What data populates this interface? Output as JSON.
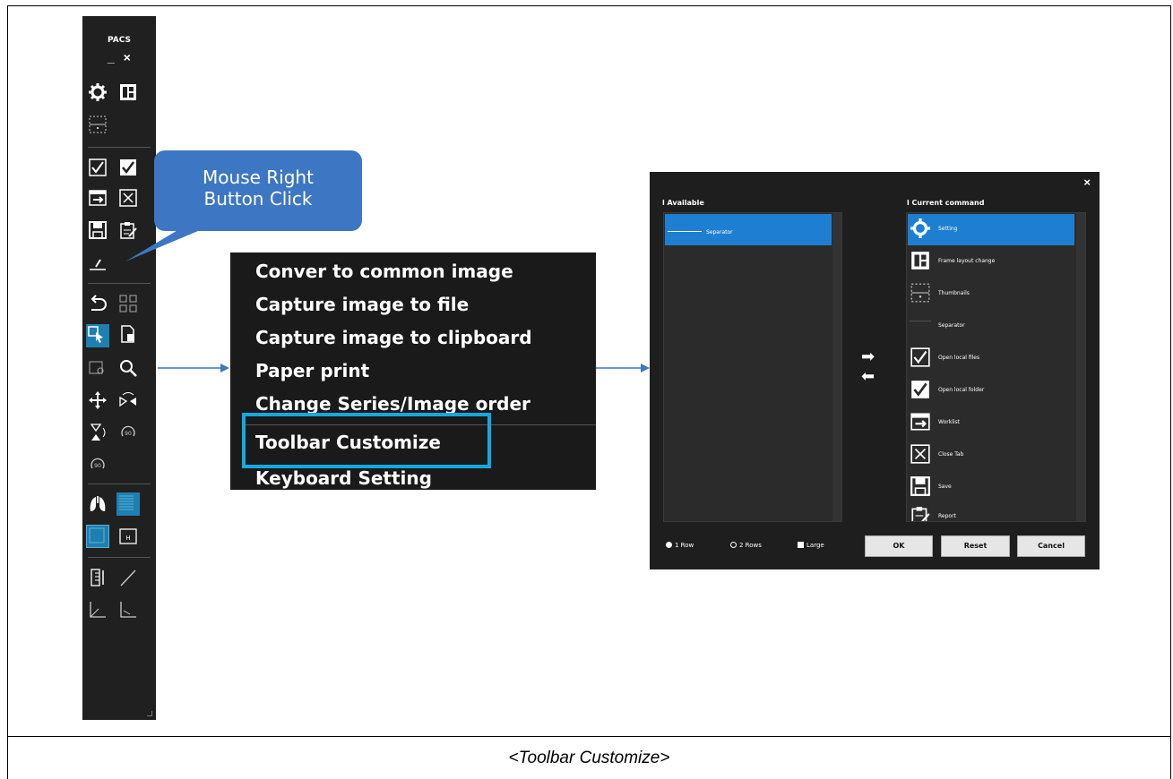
{
  "toolbar": {
    "title": "PACS",
    "window_buttons": "_ ×"
  },
  "callout": {
    "line1": "Mouse Right",
    "line2": "Button Click"
  },
  "context_menu": {
    "items": [
      "Conver to common image",
      "Capture image to file",
      "Capture image to clipboard",
      "Paper print",
      "Change Series/Image order",
      "Toolbar Customize",
      "Keyboard Setting"
    ],
    "highlighted": "Toolbar Customize"
  },
  "dialog": {
    "close_label": "×",
    "available_label": "l Available",
    "current_label": "l Current command",
    "available_items": [
      "Separator"
    ],
    "current_items": [
      {
        "label": "Setting",
        "icon": "gear-icon"
      },
      {
        "label": "Frame layout change",
        "icon": "layout-icon"
      },
      {
        "label": "Thumbnails",
        "icon": "thumbnails-icon"
      },
      {
        "label": "Separator",
        "icon": "separator-icon"
      },
      {
        "label": "Open local files",
        "icon": "check-box-icon"
      },
      {
        "label": "Open local folder",
        "icon": "check-filled-icon"
      },
      {
        "label": "Worklist",
        "icon": "worklist-icon"
      },
      {
        "label": "Close Tab",
        "icon": "close-box-icon"
      },
      {
        "label": "Save",
        "icon": "save-icon"
      },
      {
        "label": "Report",
        "icon": "report-icon"
      }
    ],
    "options": {
      "row1": "1 Row",
      "row2": "2 Rows",
      "large": "Large"
    },
    "buttons": {
      "ok": "OK",
      "reset": "Reset",
      "cancel": "Cancel"
    }
  },
  "caption": "<Toolbar Customize>",
  "colors": {
    "accent": "#1e7fd2",
    "highlight": "#14a8e0",
    "callout": "#3d77c3",
    "toolbar_active": "#1e7fb0"
  }
}
